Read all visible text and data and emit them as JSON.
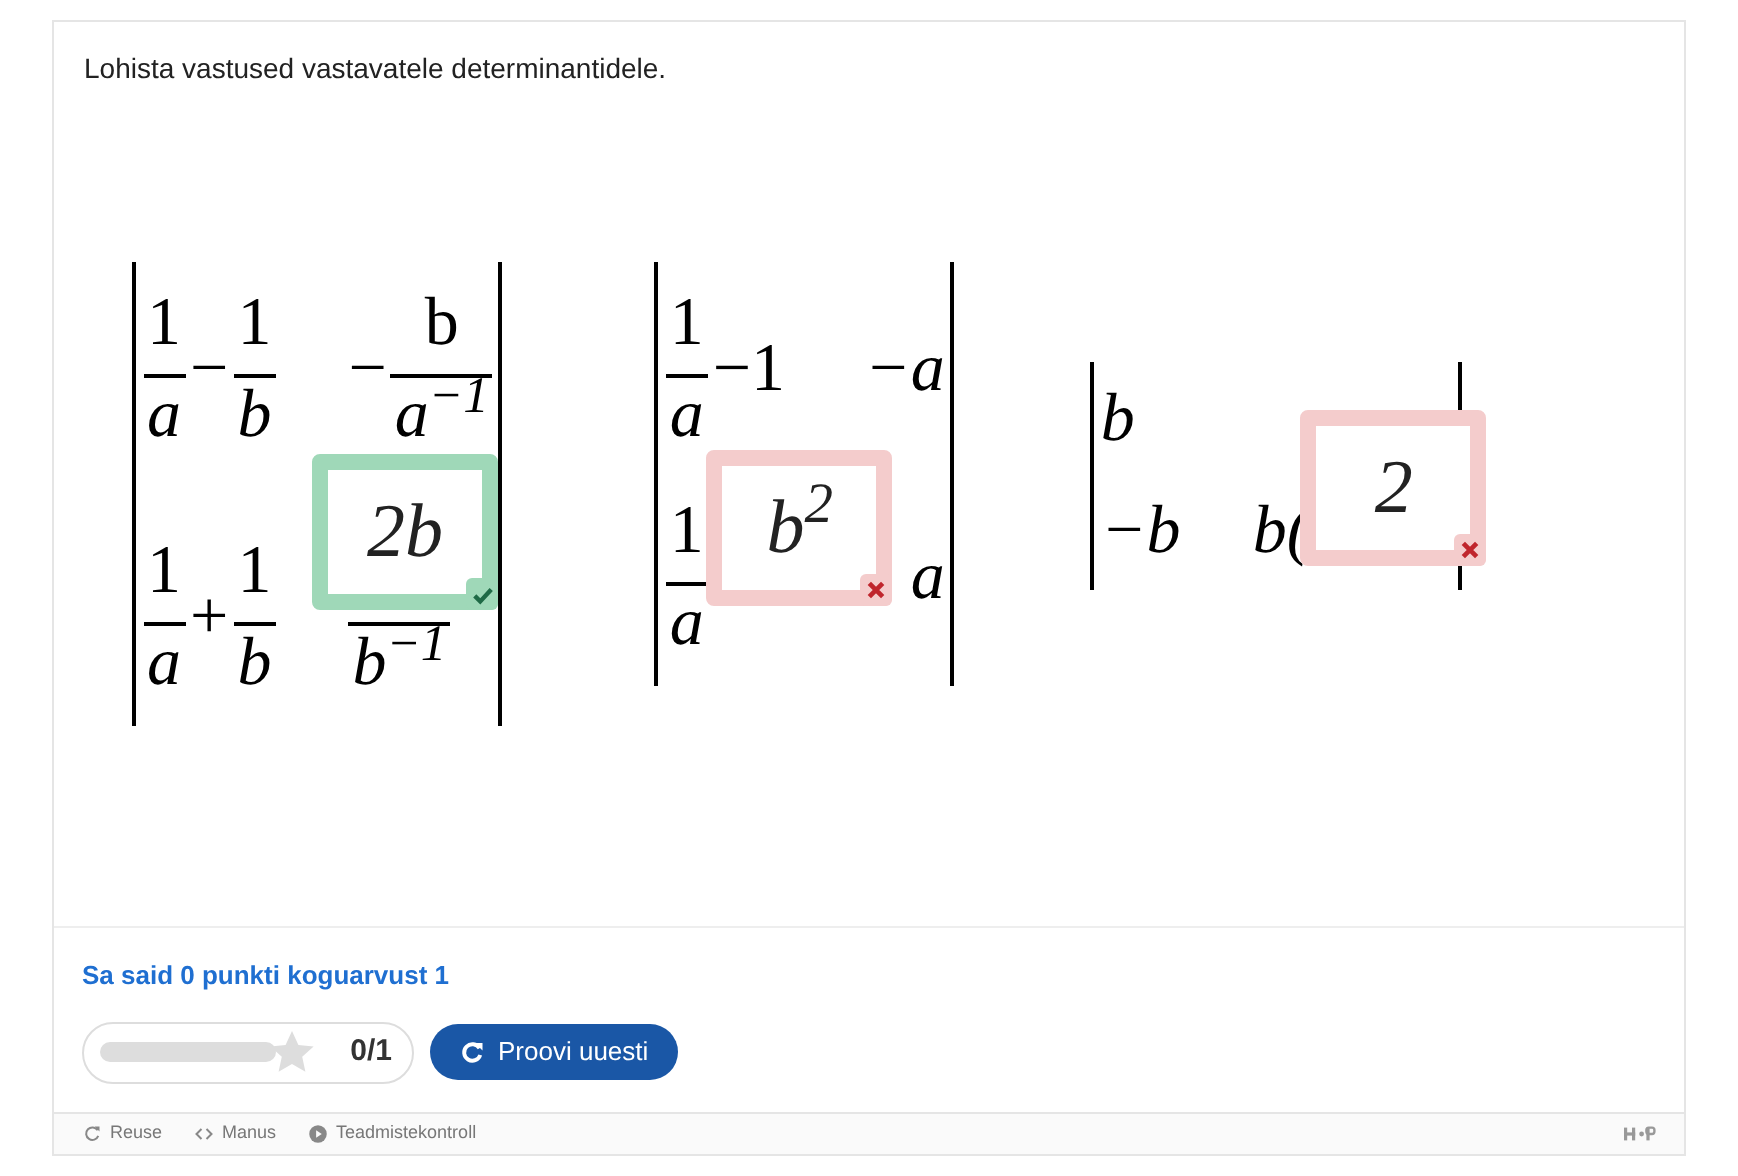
{
  "question": "Lohista vastused vastavatele determinantidele.",
  "determinants": [
    {
      "rows": [
        [
          [
            {
              "kind": "frac",
              "num": "1",
              "den": "a"
            },
            {
              "kind": "op",
              "text": "−"
            },
            {
              "kind": "frac",
              "num": "1",
              "den": "b"
            }
          ],
          [
            {
              "kind": "op",
              "text": "−"
            },
            {
              "kind": "frac",
              "num": "b",
              "den": "a$^{−1}$"
            }
          ]
        ],
        [
          [
            {
              "kind": "frac",
              "num": "1",
              "den": "a"
            },
            {
              "kind": "op",
              "text": "+"
            },
            {
              "kind": "frac",
              "num": "1",
              "den": "b"
            }
          ],
          [
            {
              "kind": "frac",
              "den": "b$^{−1}$"
            }
          ]
        ]
      ],
      "answer": {
        "text": "2b",
        "correct": true
      }
    },
    {
      "rows": [
        [
          [
            {
              "kind": "frac",
              "num": "1",
              "den": "a"
            },
            {
              "kind": "op",
              "text": "−1"
            }
          ],
          [
            {
              "kind": "sym",
              "text": "−a"
            }
          ]
        ],
        [
          [
            {
              "kind": "frac",
              "num": "1",
              "den": "a"
            }
          ],
          [
            {
              "kind": "sym",
              "text": "a"
            }
          ]
        ]
      ],
      "answer": {
        "text": "b$^{2}$",
        "correct": false
      }
    },
    {
      "rows": [
        [
          [
            {
              "kind": "sym",
              "text": "b"
            }
          ],
          []
        ],
        [
          [
            {
              "kind": "sym",
              "text": "−b"
            }
          ],
          [
            {
              "kind": "sym",
              "text": "b("
            }
          ]
        ]
      ],
      "answer": {
        "text": "2",
        "correct": false
      }
    }
  ],
  "feedback": "Sa said 0 punkti koguarvust 1",
  "score": {
    "level": 0,
    "text": "0/1"
  },
  "retry_button": "Proovi uuesti",
  "footer": [
    {
      "kind": "reuse",
      "label": "Reuse"
    },
    {
      "kind": "embed",
      "label": "Manus"
    },
    {
      "kind": "info",
      "label": "Teadmistekontroll"
    }
  ]
}
